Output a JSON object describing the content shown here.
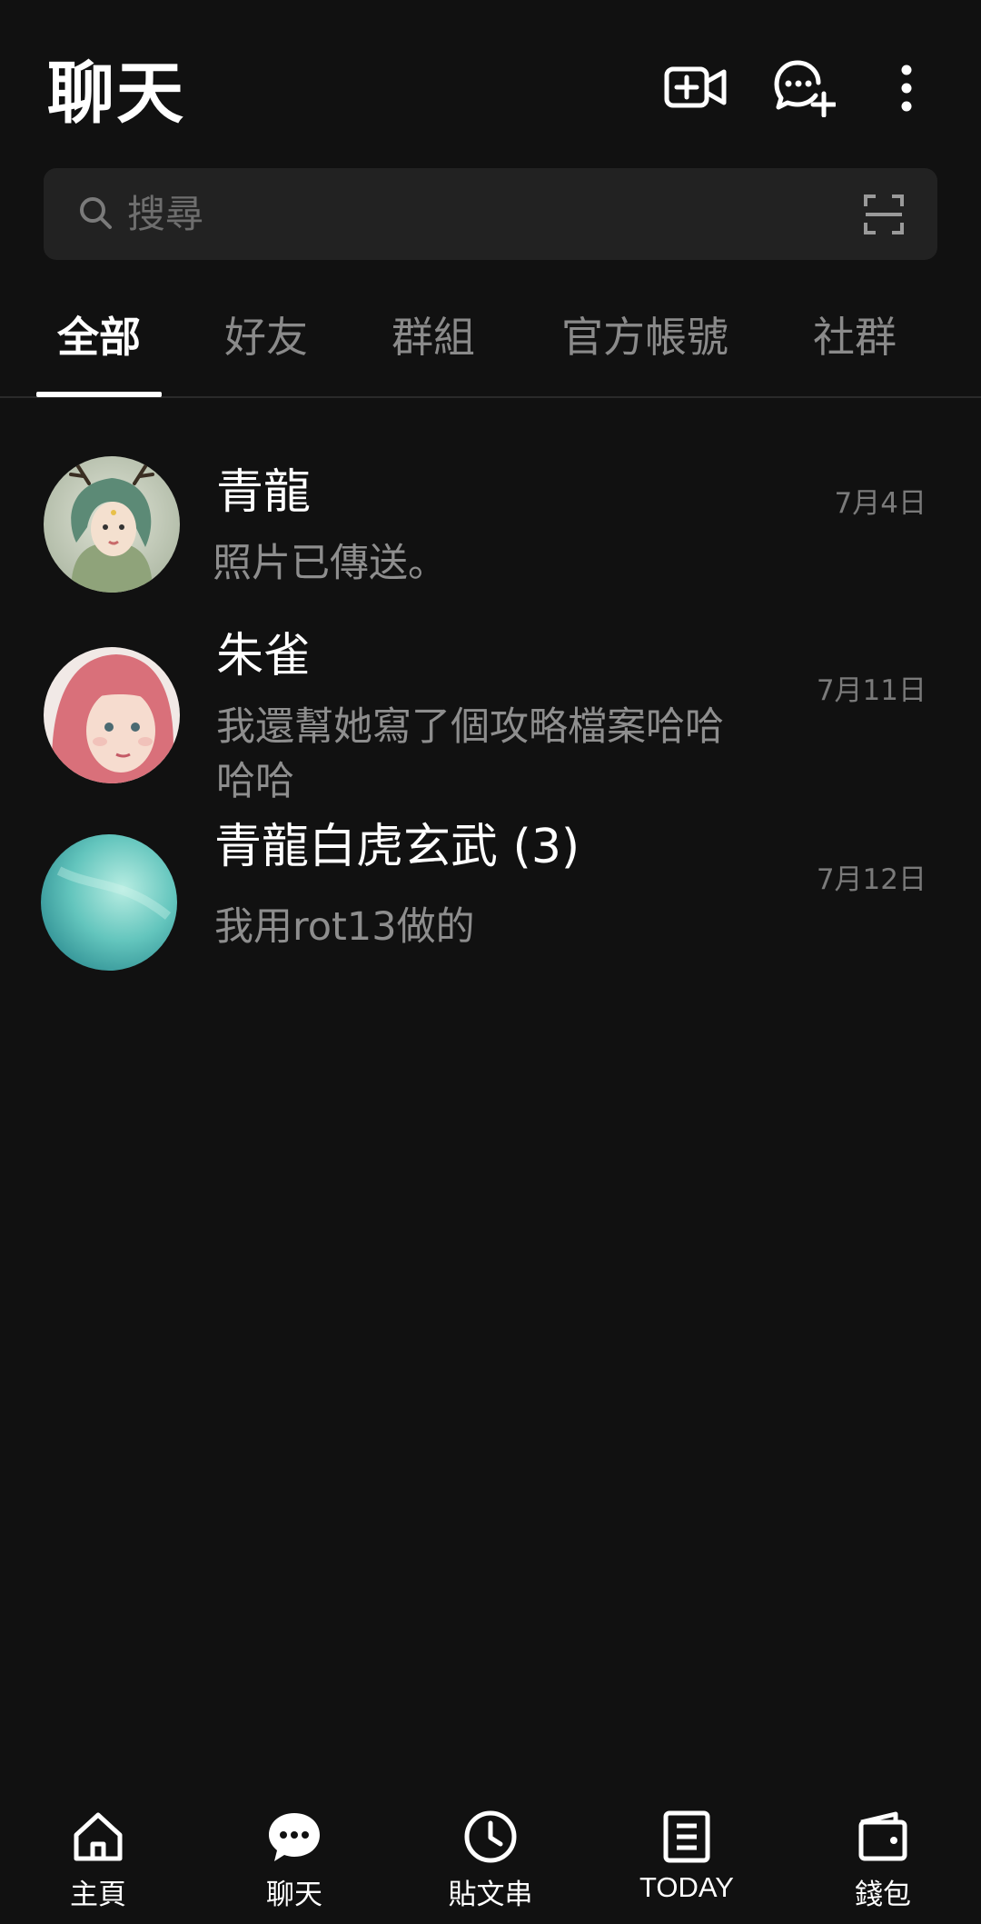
{
  "header": {
    "title": "聊天"
  },
  "search": {
    "placeholder": "搜尋"
  },
  "tabs": [
    {
      "label": "全部",
      "active": true
    },
    {
      "label": "好友",
      "active": false
    },
    {
      "label": "群組",
      "active": false
    },
    {
      "label": "官方帳號",
      "active": false
    },
    {
      "label": "社群",
      "active": false
    }
  ],
  "chats": [
    {
      "name": "青龍",
      "preview": "照片已傳送。",
      "date": "7月4日"
    },
    {
      "name": "朱雀",
      "preview": "我還幫她寫了個攻略檔案哈哈哈哈",
      "date": "7月11日"
    },
    {
      "name": "青龍白虎玄武 (3)",
      "preview": "我用rot13做的",
      "date": "7月12日"
    }
  ],
  "bottom_nav": [
    {
      "label": "主頁",
      "icon": "home-icon"
    },
    {
      "label": "聊天",
      "icon": "chat-bubble-icon"
    },
    {
      "label": "貼文串",
      "icon": "clock-icon"
    },
    {
      "label": "TODAY",
      "icon": "news-icon"
    },
    {
      "label": "錢包",
      "icon": "wallet-icon"
    }
  ],
  "colors": {
    "background": "#111111",
    "search_background": "#222222",
    "primary_text": "#ffffff",
    "secondary_text": "#8e8e8e",
    "inactive_tab": "#8a8a8a"
  }
}
